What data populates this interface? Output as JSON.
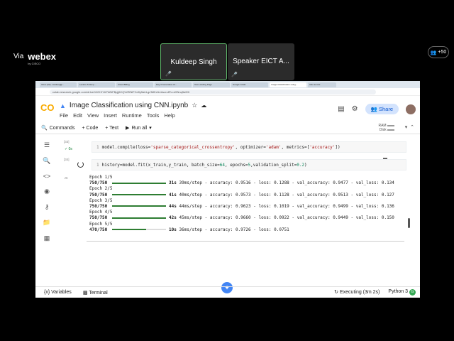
{
  "webex": {
    "via": "Via",
    "brand": "webex",
    "sub": "by CISCO"
  },
  "participants": [
    {
      "name": "Kuldeep Singh",
      "active": true
    },
    {
      "name": "Speaker EICT A...",
      "active": false
    }
  ],
  "overflow_count": "+50",
  "browser": {
    "tabs": [
      "Inbox (93) - kuldeep@...",
      "Lecture 5 Deep ...",
      "Cloud Billing",
      "Day 3 Generative AI...",
      "Test Landing Page",
      "Google Colab",
      "Image Classification using...",
      "Ask Gemini"
    ],
    "active_tab_index": 6,
    "url": "colab.research.google.com/drive/1WXXYA7WNFBpjj6CQVrRfNlFCd0y5aIrLgr/fbfKd1rr#scrollTo=d9Nnq5a9Hi"
  },
  "colab": {
    "logo": "CO",
    "notebook_title": "Image Classification using CNN.ipynb",
    "menus": [
      "File",
      "Edit",
      "View",
      "Insert",
      "Runtime",
      "Tools",
      "Help"
    ],
    "share_label": "Share",
    "toolbar": {
      "commands": "Commands",
      "code": "+ Code",
      "text": "+ Text",
      "run_all": "Run all",
      "ram": "RAM",
      "disk": "Disk"
    },
    "cells": [
      {
        "count": "[33]",
        "timing": "0s",
        "line_no": "1",
        "code_prefix": "model.compile(loss=",
        "loss_str": "'sparse_categorical_crossentropy'",
        "mid": ", optimizer=",
        "opt_str": "'adam'",
        "mid2": ", metrics=[",
        "metric_str": "'accuracy'",
        "suffix": "])"
      },
      {
        "count": "[34]",
        "line_no": "1",
        "code_prefix": "history=model.fit(x_train,y_train, batch_size=",
        "batch": "64",
        "mid": ", epochs=",
        "epochs": "5",
        "mid2": ",validation_split=",
        "split": "0.2",
        "suffix": ")"
      }
    ],
    "output": [
      {
        "epoch": "Epoch 1/5",
        "steps": "750/750",
        "fill": 1.0,
        "time": "31s",
        "rest": "39ms/step - accuracy: 0.9516 - loss: 0.1288 - val_accuracy: 0.9477 - val_loss: 0.134"
      },
      {
        "epoch": "Epoch 2/5",
        "steps": "750/750",
        "fill": 1.0,
        "time": "41s",
        "rest": "40ms/step - accuracy: 0.9573 - loss: 0.1128 - val_accuracy: 0.9513 - val_loss: 0.127"
      },
      {
        "epoch": "Epoch 3/5",
        "steps": "750/750",
        "fill": 1.0,
        "time": "44s",
        "rest": "44ms/step - accuracy: 0.9623 - loss: 0.1019 - val_accuracy: 0.9499 - val_loss: 0.136"
      },
      {
        "epoch": "Epoch 4/5",
        "steps": "750/750",
        "fill": 1.0,
        "time": "42s",
        "rest": "45ms/step - accuracy: 0.9660 - loss: 0.0922 - val_accuracy: 0.9449 - val_loss: 0.150"
      },
      {
        "epoch": "Epoch 5/5",
        "steps": "470/750",
        "fill": 0.627,
        "time": "10s",
        "rest": "36ms/step - accuracy: 0.9726 - loss: 0.0751"
      }
    ],
    "status": {
      "variables": "Variables",
      "terminal": "Terminal",
      "executing": "Executing (3m 2s)",
      "kernel": "Python 3"
    }
  }
}
